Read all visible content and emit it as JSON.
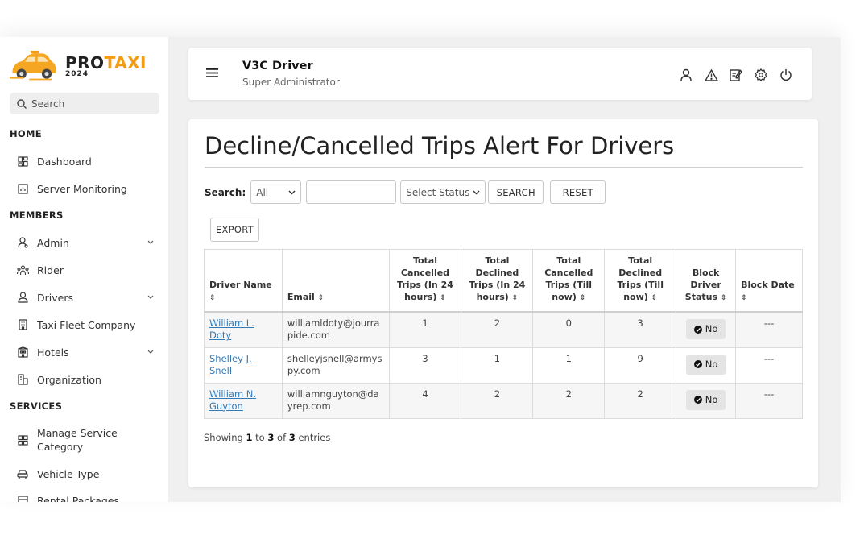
{
  "brand": {
    "title_pro": "PRO",
    "title_taxi": "TAXI",
    "year": "2024",
    "accent": "#f39c12"
  },
  "sidebar": {
    "search_placeholder": "Search",
    "sections": {
      "home": "HOME",
      "members": "MEMBERS",
      "services": "SERVICES"
    },
    "items": [
      {
        "label": "Dashboard",
        "icon": "dashboard-icon"
      },
      {
        "label": "Server Monitoring",
        "icon": "chart-icon"
      },
      {
        "label": "Admin",
        "icon": "admin-user-icon"
      },
      {
        "label": "Rider",
        "icon": "rider-group-icon"
      },
      {
        "label": "Drivers",
        "icon": "driver-icon"
      },
      {
        "label": "Taxi Fleet Company",
        "icon": "building-icon"
      },
      {
        "label": "Hotels",
        "icon": "hotel-icon"
      },
      {
        "label": "Organization",
        "icon": "organization-icon"
      },
      {
        "label": "Manage Service Category",
        "icon": "grid-icon"
      },
      {
        "label": "Vehicle Type",
        "icon": "vehicle-icon"
      },
      {
        "label": "Rental Packages",
        "icon": "package-icon"
      }
    ]
  },
  "header": {
    "title": "V3C Driver",
    "subtitle": "Super Administrator"
  },
  "main": {
    "page_title": "Decline/Cancelled Trips Alert For Drivers",
    "filter": {
      "label": "Search:",
      "scope_value": "All",
      "status_value": "Select Status",
      "search_button": "SEARCH",
      "reset_button": "RESET"
    },
    "export_button": "EXPORT",
    "table": {
      "headers": [
        "Driver Name",
        "Email",
        "Total Cancelled Trips (In 24 hours)",
        "Total Declined Trips (In 24 hours)",
        "Total Cancelled Trips (Till now)",
        "Total Declined Trips (Till now)",
        "Block Driver Status",
        "Block Date"
      ],
      "rows": [
        {
          "name": "William L. Doty",
          "email": "williamldoty@jourrapide.com",
          "c24": "1",
          "d24": "2",
          "call": "0",
          "dall": "3",
          "status": "No",
          "date": "---"
        },
        {
          "name": "Shelley J. Snell",
          "email": "shelleyjsnell@armyspy.com",
          "c24": "3",
          "d24": "1",
          "call": "1",
          "dall": "9",
          "status": "No",
          "date": "---"
        },
        {
          "name": "William N. Guyton",
          "email": "williamnguyton@dayrep.com",
          "c24": "4",
          "d24": "2",
          "call": "2",
          "dall": "2",
          "status": "No",
          "date": "---"
        }
      ]
    },
    "showing": {
      "prefix": "Showing",
      "from": "1",
      "to_word": "to",
      "to": "3",
      "of_word": "of",
      "total": "3",
      "suffix": "entries"
    }
  }
}
